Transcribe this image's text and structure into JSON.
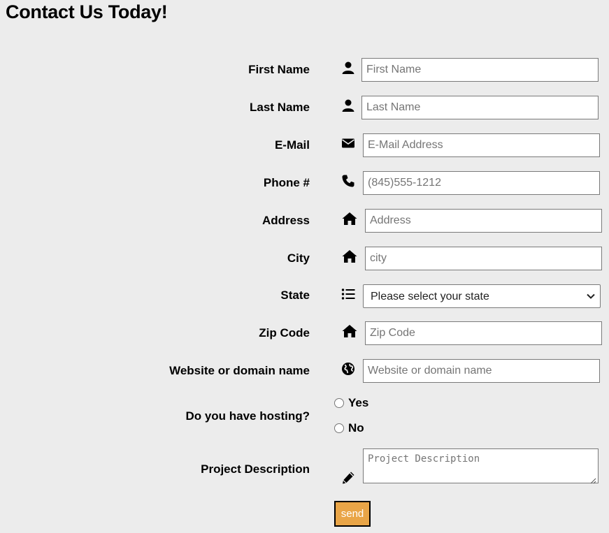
{
  "page": {
    "title": "Contact Us Today!"
  },
  "form": {
    "first_name": {
      "label": "First Name",
      "placeholder": "First Name",
      "icon": "user-icon"
    },
    "last_name": {
      "label": "Last Name",
      "placeholder": "Last Name",
      "icon": "user-icon"
    },
    "email": {
      "label": "E-Mail",
      "placeholder": "E-Mail Address",
      "icon": "envelope-icon"
    },
    "phone": {
      "label": "Phone #",
      "placeholder": "(845)555-1212",
      "icon": "phone-icon"
    },
    "address": {
      "label": "Address",
      "placeholder": "Address",
      "icon": "home-icon"
    },
    "city": {
      "label": "City",
      "placeholder": "city",
      "icon": "home-icon"
    },
    "state": {
      "label": "State",
      "selected": "Please select your state",
      "icon": "list-icon"
    },
    "zip": {
      "label": "Zip Code",
      "placeholder": "Zip Code",
      "icon": "home-icon"
    },
    "website": {
      "label": "Website or domain name",
      "placeholder": "Website or domain name",
      "icon": "globe-icon"
    },
    "hosting": {
      "label": "Do you have hosting?",
      "options": [
        "Yes",
        "No"
      ]
    },
    "description": {
      "label": "Project Description",
      "placeholder": "Project Description",
      "icon": "pencil-icon"
    },
    "send_label": "send"
  },
  "colors": {
    "background": "#ececec",
    "send_button": "#e9a547",
    "field_border": "#7a7a7a"
  }
}
